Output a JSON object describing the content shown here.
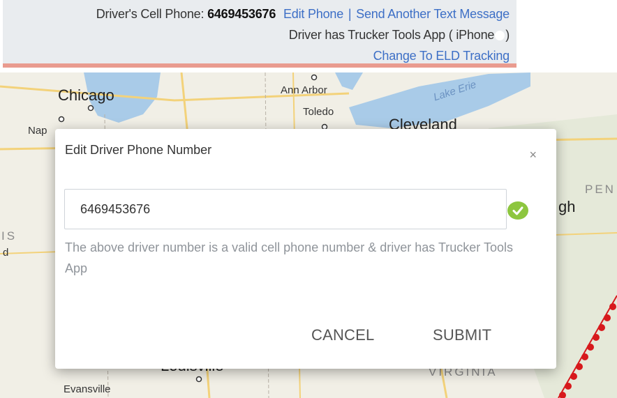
{
  "info_panel": {
    "phone_label": "Driver's Cell Phone:",
    "phone_number": "6469453676",
    "edit_phone_link": "Edit Phone",
    "separator": "|",
    "send_text_link": "Send Another Text Message",
    "app_status_prefix": "Driver has Trucker Tools App ( iPhone",
    "app_status_suffix": ")",
    "change_tracking_link": "Change To ELD Tracking"
  },
  "map": {
    "labels": {
      "chicago": "Chicago",
      "ann_arbor": "Ann Arbor",
      "lake_erie": "Lake Erie",
      "toledo": "Toledo",
      "cleveland": "Cleveland",
      "naperville": "Nap",
      "pennsylvania": "PEN",
      "pittsburgh_partial": "gh",
      "illinois_partial": "IS",
      "indiana_partial": "d",
      "louisville": "Louisville",
      "virginia": "VIRGINIA",
      "evansville": "Evansville"
    }
  },
  "modal": {
    "title": "Edit Driver Phone Number",
    "close_glyph": "×",
    "phone_value": "6469453676",
    "help_text": "The above driver number is a valid cell phone number & driver has Trucker Tools App",
    "cancel_label": "CANCEL",
    "submit_label": "SUBMIT"
  },
  "colors": {
    "valid_icon": "#8dc63f",
    "link": "#3d6fc6",
    "accent_bar": "#e99b8f",
    "route_markers": "#d7191c"
  }
}
